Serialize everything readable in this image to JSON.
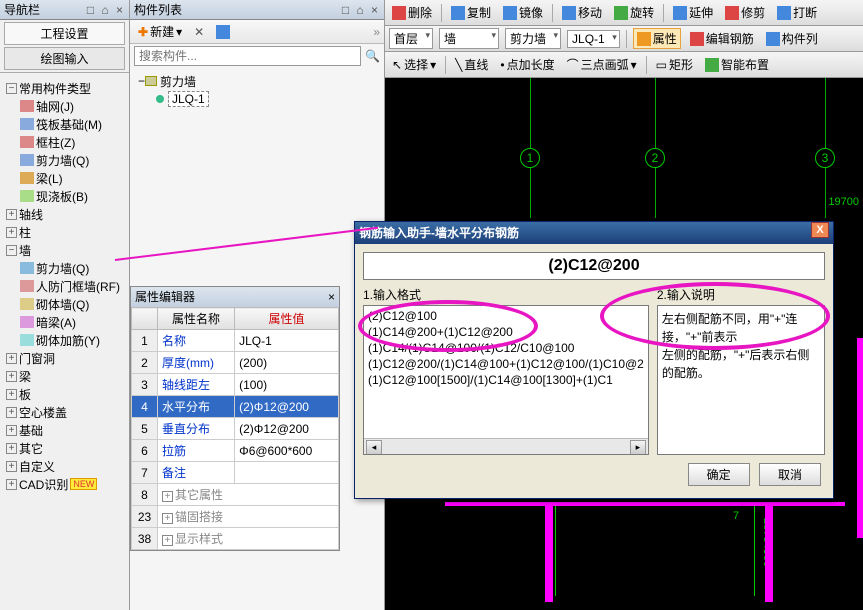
{
  "leftPanel": {
    "title": "导航栏",
    "btn1": "工程设置",
    "btn2": "绘图输入",
    "treeHeader": "常用构件类型",
    "nodes": [
      {
        "label": "轴网(J)",
        "icon": "#d88"
      },
      {
        "label": "筏板基础(M)",
        "icon": "#8ad"
      },
      {
        "label": "框柱(Z)",
        "icon": "#d88"
      },
      {
        "label": "剪力墙(Q)",
        "icon": "#8ad"
      },
      {
        "label": "梁(L)",
        "icon": "#da5"
      },
      {
        "label": "现浇板(B)",
        "icon": "#ad8"
      }
    ],
    "groups": [
      "轴线",
      "柱",
      "墙"
    ],
    "wallSub": [
      {
        "label": "剪力墙(Q)"
      },
      {
        "label": "人防门框墙(RF)"
      },
      {
        "label": "砌体墙(Q)"
      },
      {
        "label": "暗梁(A)"
      },
      {
        "label": "砌体加筋(Y)"
      }
    ],
    "more": [
      "门窗洞",
      "梁",
      "板",
      "空心楼盖",
      "基础",
      "其它",
      "自定义"
    ],
    "cad": "CAD识别",
    "newBadge": "NEW"
  },
  "midPanel": {
    "title": "构件列表",
    "newBtn": "新建",
    "searchPlaceholder": "搜索构件...",
    "root": "剪力墙",
    "item": "JLQ-1"
  },
  "propEditor": {
    "title": "属性编辑器",
    "colName": "属性名称",
    "colVal": "属性值",
    "rows": [
      {
        "n": "1",
        "name": "名称",
        "val": "JLQ-1"
      },
      {
        "n": "2",
        "name": "厚度(mm)",
        "val": "(200)"
      },
      {
        "n": "3",
        "name": "轴线距左",
        "val": "(100)"
      },
      {
        "n": "4",
        "name": "水平分布",
        "val": "(2)Φ12@200",
        "sel": true
      },
      {
        "n": "5",
        "name": "垂直分布",
        "val": "(2)Φ12@200"
      },
      {
        "n": "6",
        "name": "拉筋",
        "val": "Φ6@600*600"
      },
      {
        "n": "7",
        "name": "备注",
        "val": ""
      }
    ],
    "exp": [
      {
        "n": "8",
        "name": "其它属性"
      },
      {
        "n": "23",
        "name": "锚固搭接"
      },
      {
        "n": "38",
        "name": "显示样式"
      }
    ]
  },
  "topTb": {
    "del": "删除",
    "copy": "复制",
    "mirror": "镜像",
    "move": "移动",
    "rotate": "旋转",
    "extend": "延伸",
    "trim": "修剪",
    "break": "打断",
    "floor": "首层",
    "wall": "墙",
    "shear": "剪力墙",
    "jlq": "JLQ-1",
    "attr": "属性",
    "editbar": "编辑钢筋",
    "complist": "构件列",
    "select": "选择",
    "line": "直线",
    "ptlen": "点加长度",
    "arc3": "三点画弧",
    "rect": "矩形",
    "smart": "智能布置"
  },
  "canvas": {
    "b1": "1",
    "b2": "2",
    "b3": "3",
    "dim": "19700",
    "vdim": "23754580",
    "seven": "7"
  },
  "dialog": {
    "title": "钢筋输入助手-墙水平分布钢筋",
    "value": "(2)C12@200",
    "lab1": "1.输入格式",
    "lab2": "2.输入说明",
    "list": [
      "(2)C12@100",
      "(1)C14@200+(1)C12@200",
      "(1)C14/(1)C14@100/(1)C12/C10@100",
      "(1)C12@200/(1)C14@100+(1)C12@100/(1)C10@2",
      "(1)C12@100[1500]/(1)C14@100[1300]+(1)C1"
    ],
    "desc1": "左右侧配筋不同，用\"+\"连接，\"+\"前表示",
    "desc2": "左侧的配筋，\"+\"后表示右侧的配筋。",
    "ok": "确定",
    "cancel": "取消"
  }
}
